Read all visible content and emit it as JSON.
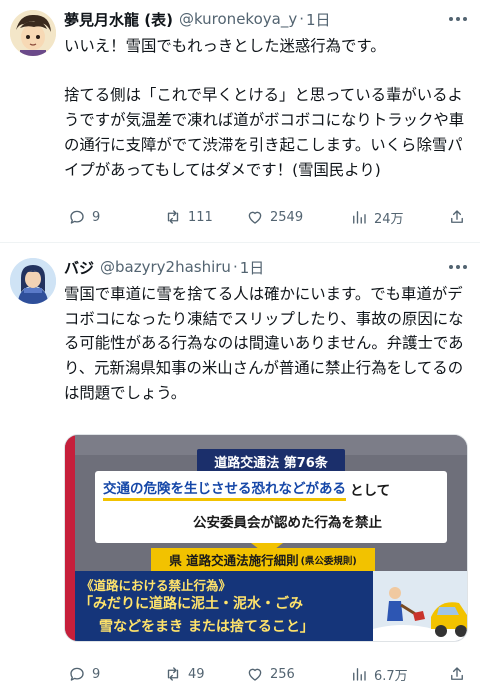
{
  "tweets": [
    {
      "name": "夢見月水龍 (表)",
      "handle": "@kuronekoya_y",
      "separator": "·",
      "time": "1日",
      "paragraphs": [
        "いいえ！雪国でもれっきとした迷惑行為です。",
        "捨てる側は「これで早くとける」と思っている輩がいるようですが気温差で凍れば道がボコボコになりトラックや車の通行に支障がでて渋滞を引き起こします。いくら除雪パイプがあってもしてはダメです！(雪国民より)"
      ],
      "stats": {
        "replies": "9",
        "retweets": "111",
        "likes": "2549",
        "views": "24万"
      }
    },
    {
      "name": "バジ",
      "handle": "@bazyry2hashiru",
      "separator": "·",
      "time": "1日",
      "paragraphs": [
        "雪国で車道に雪を捨てる人は確かにいます。でも車道がデコボコになったり凍結でスリップしたり、事故の原因になる可能性がある行為なのは間違いありません。弁護士であり、元新潟県知事の米山さんが普通に禁止行為をしてるのは問題でしょう。"
      ],
      "media": {
        "law_title": "道路交通法 第76条",
        "highlight": "交通の危険を生じさせる恐れなどがある",
        "highlight_tail": "として",
        "line2": "公安委員会が認めた行為を禁止",
        "sub_title": "県 道路交通法施行細則",
        "sub_note": "(県公委規則)",
        "caption": "《道路における禁止行為》",
        "quote_line1": "「みだりに道路に泥土・泥水・ごみ",
        "quote_line2": "雪などをまき または捨てること」"
      },
      "stats": {
        "replies": "9",
        "retweets": "49",
        "likes": "256",
        "views": "6.7万"
      }
    }
  ],
  "colors": {
    "text": "#0f1419",
    "muted": "#536471",
    "divider": "#eff3f4"
  }
}
